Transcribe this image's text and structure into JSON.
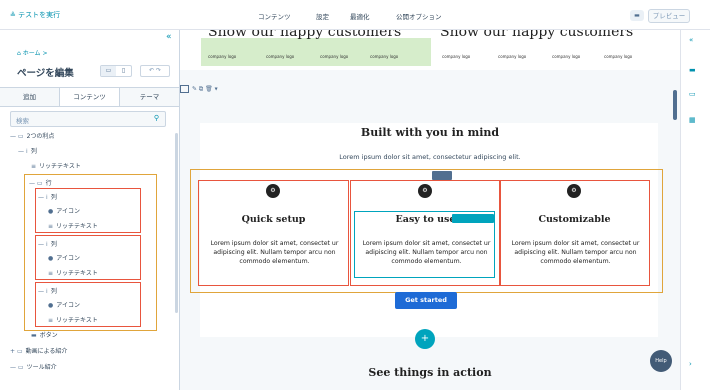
{
  "topbar": {
    "test_run": "テストを実行",
    "nav": [
      "コンテンツ",
      "設定",
      "最適化",
      "公開オプション"
    ],
    "preview": "プレビュー",
    "chat_icon": "chat-icon"
  },
  "sidebar": {
    "breadcrumb": "ホーム >",
    "title": "ページを編集",
    "tabs": [
      "追加",
      "コンテンツ",
      "テーマ"
    ],
    "search_placeholder": "検索",
    "tree": [
      {
        "label": "2つの利点",
        "glyph": "▭"
      },
      {
        "label": "列",
        "glyph": "⁞"
      },
      {
        "label": "リッチテキスト",
        "glyph": "≡"
      },
      {
        "label": "行",
        "glyph": "▭"
      },
      {
        "label": "列",
        "glyph": "⁞"
      },
      {
        "label": "アイコン",
        "glyph": "●"
      },
      {
        "label": "リッチテキスト",
        "glyph": "≡"
      },
      {
        "label": "列",
        "glyph": "⁞"
      },
      {
        "label": "アイコン",
        "glyph": "●"
      },
      {
        "label": "リッチテキスト",
        "glyph": "≡"
      },
      {
        "label": "列",
        "glyph": "⁞"
      },
      {
        "label": "アイコン",
        "glyph": "●"
      },
      {
        "label": "リッチテキスト",
        "glyph": "≡"
      },
      {
        "label": "ボタン",
        "glyph": "▬"
      },
      {
        "label": "動画による紹介",
        "glyph": "▭"
      },
      {
        "label": "ツール紹介",
        "glyph": "▭"
      }
    ]
  },
  "canvas": {
    "banner_left": "Show our happy customers",
    "banner_right": "Show our happy customers",
    "logos": [
      "company logo",
      "company logo",
      "company logo",
      "company logo",
      "company logo",
      "company logo",
      "company logo",
      "company logo"
    ],
    "section_title": "Built with you in mind",
    "section_sub": "Lorem ipsum dolor sit amet, consectetur adipiscing elit.",
    "columns": [
      {
        "heading": "Quick setup",
        "body": "Lorem ipsum dolor sit amet, consectet ur adipiscing elit. Nullam tempor arcu non commodo elementum."
      },
      {
        "heading": "Easy to use",
        "body": "Lorem ipsum dolor sit amet, consectet ur adipiscing elit. Nullam tempor arcu non commodo elementum."
      },
      {
        "heading": "Customizable",
        "body": "Lorem ipsum dolor sit amet, consectet ur adipiscing elit. Nullam tempor arcu non commodo elementum."
      }
    ],
    "cta": "Get started",
    "next_section": "See things in action",
    "help": "Help"
  },
  "colors": {
    "accent": "#0091ae",
    "row_outline": "#e0a53b",
    "column_outline": "#e8553e",
    "cta": "#1e6bd6"
  }
}
